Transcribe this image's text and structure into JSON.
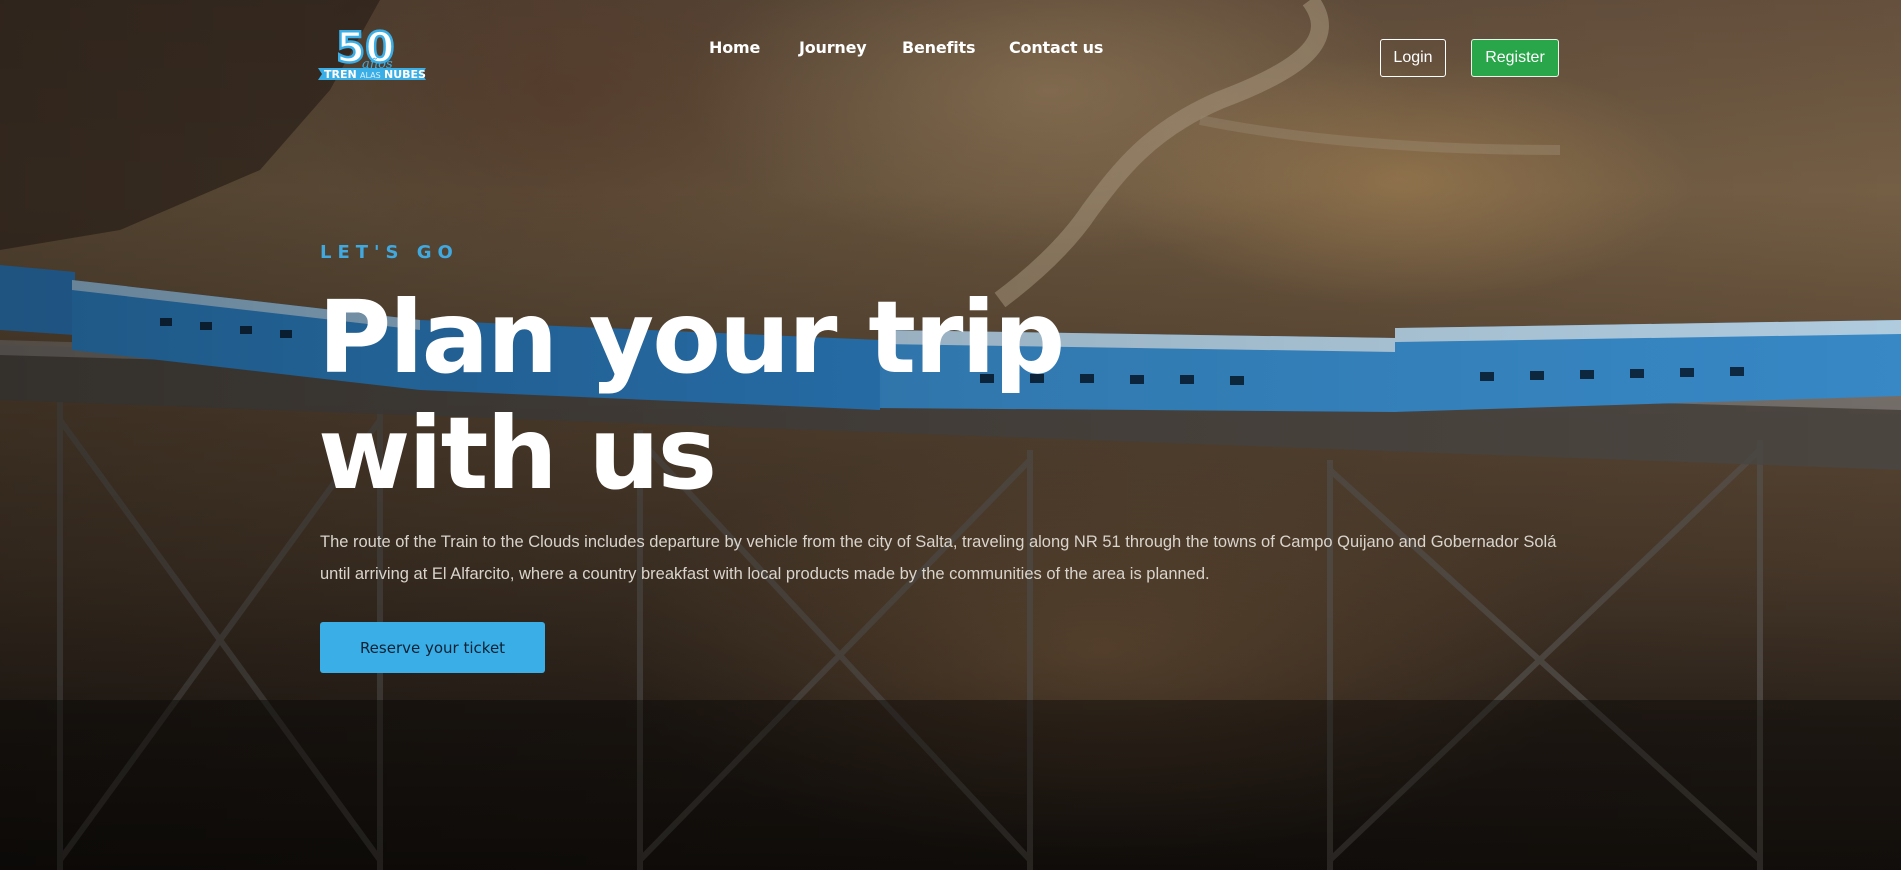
{
  "brand": {
    "logo_number": "50",
    "logo_script": "años",
    "logo_word_1": "TREN",
    "logo_word_2": "ALAS",
    "logo_word_3": "NUBES"
  },
  "nav": {
    "items": [
      {
        "label": "Home"
      },
      {
        "label": "Journey"
      },
      {
        "label": "Benefits"
      },
      {
        "label": "Contact us"
      }
    ],
    "login_label": "Login",
    "register_label": "Register"
  },
  "hero": {
    "eyebrow": "LET'S GO",
    "headline_line_1": "Plan your trip",
    "headline_line_2": "with us",
    "description": "The route of the Train to the Clouds includes departure by vehicle from the city of Salta, traveling along NR 51 through the towns of Campo Quijano and Gobernador Solá until arriving at El Alfarcito, where a country breakfast with local products made by the communities of the area is planned.",
    "cta_label": "Reserve your ticket"
  },
  "colors": {
    "accent_blue": "#3aaee6",
    "register_green": "#2aa64a",
    "text_white": "#ffffff"
  }
}
